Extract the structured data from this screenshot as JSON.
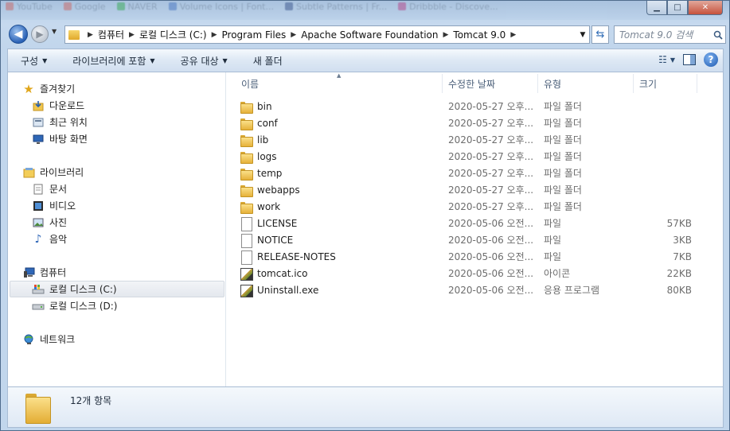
{
  "browser_tabs": [
    "YouTube",
    "Google",
    "NAVER",
    "Volume Icons | Font...",
    "Subtle Patterns | Fr...",
    "Dribbble - Discove..."
  ],
  "address": {
    "crumbs": [
      "컴퓨터",
      "로컬 디스크 (C:)",
      "Program Files",
      "Apache Software Foundation",
      "Tomcat 9.0"
    ]
  },
  "search": {
    "placeholder": "Tomcat 9.0 검색"
  },
  "toolbar": {
    "organize": "구성",
    "include_in_library": "라이브러리에 포함",
    "share_with": "공유 대상",
    "new_folder": "새 폴더"
  },
  "nav": {
    "favorites": {
      "label": "즐겨찾기",
      "items": [
        "다운로드",
        "최근 위치",
        "바탕 화면"
      ]
    },
    "libraries": {
      "label": "라이브러리",
      "items": [
        "문서",
        "비디오",
        "사진",
        "음악"
      ]
    },
    "computer": {
      "label": "컴퓨터",
      "items": [
        "로컬 디스크 (C:)",
        "로컬 디스크 (D:)"
      ]
    },
    "network": {
      "label": "네트워크"
    }
  },
  "columns": {
    "name": "이름",
    "date": "수정한 날짜",
    "type": "유형",
    "size": "크기"
  },
  "files": [
    {
      "name": "bin",
      "date": "2020-05-27 오후...",
      "type": "파일 폴더",
      "size": "",
      "icon": "folder-icon"
    },
    {
      "name": "conf",
      "date": "2020-05-27 오후...",
      "type": "파일 폴더",
      "size": "",
      "icon": "folder-icon"
    },
    {
      "name": "lib",
      "date": "2020-05-27 오후...",
      "type": "파일 폴더",
      "size": "",
      "icon": "folder-icon"
    },
    {
      "name": "logs",
      "date": "2020-05-27 오후...",
      "type": "파일 폴더",
      "size": "",
      "icon": "folder-icon"
    },
    {
      "name": "temp",
      "date": "2020-05-27 오후...",
      "type": "파일 폴더",
      "size": "",
      "icon": "folder-icon"
    },
    {
      "name": "webapps",
      "date": "2020-05-27 오후...",
      "type": "파일 폴더",
      "size": "",
      "icon": "folder-icon"
    },
    {
      "name": "work",
      "date": "2020-05-27 오후...",
      "type": "파일 폴더",
      "size": "",
      "icon": "folder-icon"
    },
    {
      "name": "LICENSE",
      "date": "2020-05-06 오전...",
      "type": "파일",
      "size": "57KB",
      "icon": "file-icon"
    },
    {
      "name": "NOTICE",
      "date": "2020-05-06 오전...",
      "type": "파일",
      "size": "3KB",
      "icon": "file-icon"
    },
    {
      "name": "RELEASE-NOTES",
      "date": "2020-05-06 오전...",
      "type": "파일",
      "size": "7KB",
      "icon": "file-icon"
    },
    {
      "name": "tomcat.ico",
      "date": "2020-05-06 오전...",
      "type": "아이콘",
      "size": "22KB",
      "icon": "image-icon"
    },
    {
      "name": "Uninstall.exe",
      "date": "2020-05-06 오전...",
      "type": "응용 프로그램",
      "size": "80KB",
      "icon": "exe-icon"
    }
  ],
  "details": {
    "count": "12개 항목"
  }
}
